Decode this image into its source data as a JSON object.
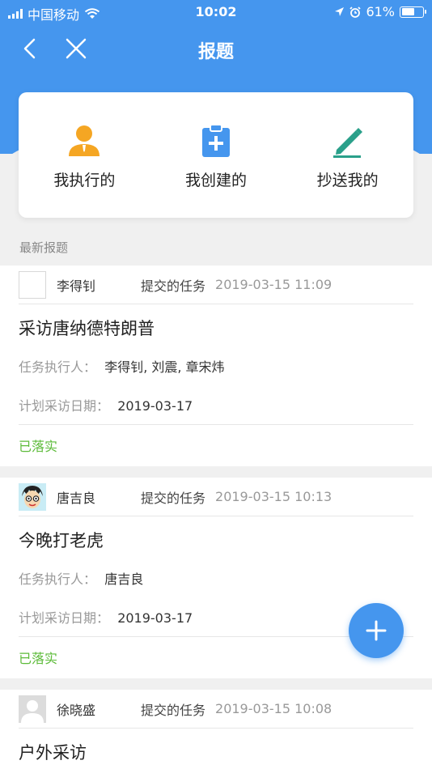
{
  "status_bar": {
    "carrier": "中国移动",
    "time": "10:02",
    "battery": "61%",
    "battery_level": 0.61
  },
  "nav": {
    "title": "报题"
  },
  "quick_actions": [
    {
      "label": "我执行的",
      "icon": "person-icon",
      "color": "#f5a623"
    },
    {
      "label": "我创建的",
      "icon": "clipboard-add-icon",
      "color": "#4596ee"
    },
    {
      "label": "抄送我的",
      "icon": "pencil-icon",
      "color": "#2aa08a"
    }
  ],
  "section": {
    "label": "最新报题"
  },
  "feed": [
    {
      "author": "李得钊",
      "tag": "提交的任务",
      "time": "2019-03-15 11:09",
      "title": "采访唐纳德特朗普",
      "executor_label": "任务执行人：",
      "executors": "李得钊, 刘震, 章宋炜",
      "date_label": "计划采访日期：",
      "date": "2019-03-17",
      "status": "已落实"
    },
    {
      "author": "唐吉良",
      "tag": "提交的任务",
      "time": "2019-03-15 10:13",
      "title": "今晚打老虎",
      "executor_label": "任务执行人：",
      "executors": "唐吉良",
      "date_label": "计划采访日期：",
      "date": "2019-03-17",
      "status": "已落实"
    },
    {
      "author": "徐晓盛",
      "tag": "提交的任务",
      "time": "2019-03-15 10:08",
      "title": "户外采访"
    }
  ],
  "colors": {
    "primary": "#4596ee",
    "success": "#5dbb3a"
  }
}
